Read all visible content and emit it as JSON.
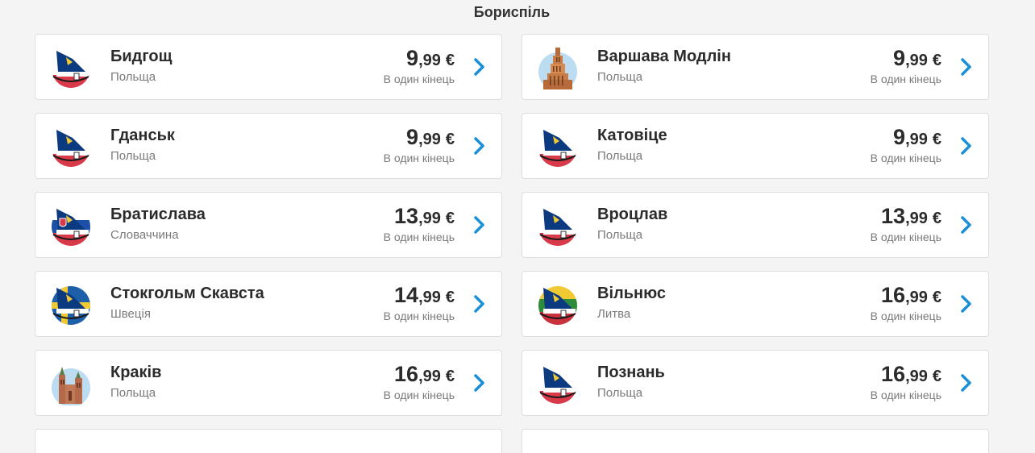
{
  "origin": "Бориспіль",
  "colors": {
    "accent": "#1a8fd8",
    "navy": "#0b3a80",
    "red": "#d83a4a",
    "gold": "#f1c933"
  },
  "destinations": [
    {
      "city": "Бидгощ",
      "country": "Польща",
      "price_int": "9",
      "price_cents": ",99",
      "currency": "€",
      "note": "В один кінець",
      "icon": "ryanair-tail-poland-icon"
    },
    {
      "city": "Варшава Модлін",
      "country": "Польща",
      "price_int": "9",
      "price_cents": ",99",
      "currency": "€",
      "note": "В один кінець",
      "icon": "palace-of-culture-warsaw-icon"
    },
    {
      "city": "Гданськ",
      "country": "Польща",
      "price_int": "9",
      "price_cents": ",99",
      "currency": "€",
      "note": "В один кінець",
      "icon": "ryanair-tail-poland-icon"
    },
    {
      "city": "Катовіце",
      "country": "Польща",
      "price_int": "9",
      "price_cents": ",99",
      "currency": "€",
      "note": "В один кінець",
      "icon": "ryanair-tail-poland-icon"
    },
    {
      "city": "Братислава",
      "country": "Словаччина",
      "price_int": "13",
      "price_cents": ",99",
      "currency": "€",
      "note": "В один кінець",
      "icon": "ryanair-tail-slovakia-icon"
    },
    {
      "city": "Вроцлав",
      "country": "Польща",
      "price_int": "13",
      "price_cents": ",99",
      "currency": "€",
      "note": "В один кінець",
      "icon": "ryanair-tail-poland-icon"
    },
    {
      "city": "Стокгольм Скавста",
      "country": "Швеція",
      "price_int": "14",
      "price_cents": ",99",
      "currency": "€",
      "note": "В один кінець",
      "icon": "ryanair-tail-sweden-icon"
    },
    {
      "city": "Вільнюс",
      "country": "Литва",
      "price_int": "16",
      "price_cents": ",99",
      "currency": "€",
      "note": "В один кінець",
      "icon": "ryanair-tail-lithuania-icon"
    },
    {
      "city": "Краків",
      "country": "Польща",
      "price_int": "16",
      "price_cents": ",99",
      "currency": "€",
      "note": "В один кінець",
      "icon": "st-marys-basilica-krakow-icon"
    },
    {
      "city": "Познань",
      "country": "Польща",
      "price_int": "16",
      "price_cents": ",99",
      "currency": "€",
      "note": "В один кінець",
      "icon": "ryanair-tail-poland-icon"
    }
  ]
}
